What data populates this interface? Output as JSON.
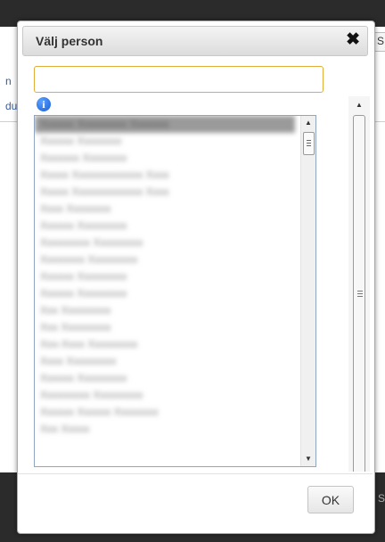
{
  "dialog": {
    "title": "Välj person",
    "close_glyph": "✖",
    "search": {
      "value": "",
      "placeholder": ""
    },
    "info_glyph": "i",
    "people": [
      "Xxxxxx Xxxxxxxxx Xxxxxxx",
      "Xxxxxx Xxxxxxxx",
      "Xxxxxxx Xxxxxxxx",
      "Xxxxx Xxxxxxxxxxxxx Xxxx",
      "Xxxxx Xxxxxxxxxxxxx Xxxx",
      "Xxxx Xxxxxxxx",
      "Xxxxxx Xxxxxxxxx",
      "Xxxxxxxxx Xxxxxxxxx",
      "Xxxxxxxx Xxxxxxxxx",
      "Xxxxxx Xxxxxxxxx",
      "Xxxxxx Xxxxxxxxx",
      "Xxx Xxxxxxxxx",
      "Xxx Xxxxxxxxx",
      "Xxx-Xxxx Xxxxxxxxx",
      "Xxxx Xxxxxxxxx",
      "Xxxxxx Xxxxxxxxx",
      "Xxxxxxxxx Xxxxxxxxx",
      "Xxxxxx Xxxxxx Xxxxxxxx",
      "Xxx Xxxxx"
    ],
    "ok_label": "OK"
  },
  "background": {
    "link1": "n",
    "link2": "du",
    "field_text": "S",
    "bottom_text": "S"
  },
  "colors": {
    "accent_border": "#e0ad3a",
    "selection": "#9a9a9a",
    "info": "#1a5fd6"
  },
  "icons": {
    "close": "close-icon",
    "info": "info-icon",
    "scroll_up": "arrow-up-icon",
    "scroll_down": "arrow-down-icon"
  }
}
